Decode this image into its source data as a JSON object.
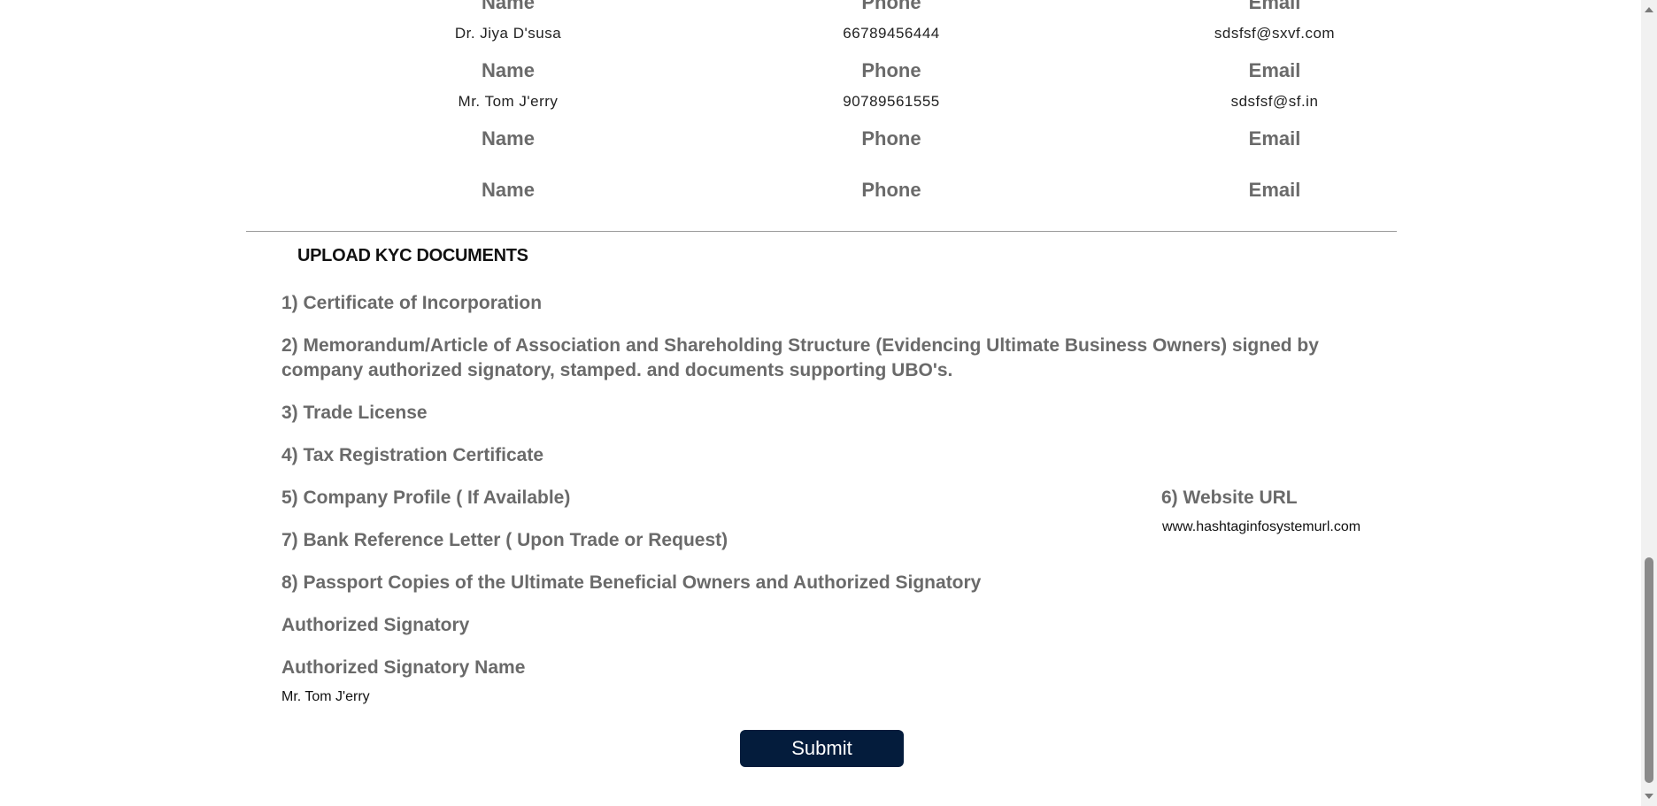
{
  "contacts": {
    "headers": {
      "name": "Name",
      "phone": "Phone",
      "email": "Email"
    },
    "rows": [
      {
        "name": "Dr. Jiya D'susa",
        "phone": "66789456444",
        "email": "sdsfsf@sxvf.com"
      },
      {
        "name": "Mr. Tom J'erry",
        "phone": "90789561555",
        "email": "sdsfsf@sf.in"
      },
      {
        "name": "",
        "phone": "",
        "email": ""
      },
      {
        "name": "",
        "phone": "",
        "email": ""
      }
    ]
  },
  "kyc": {
    "title": "UPLOAD KYC DOCUMENTS",
    "docs": {
      "d1": "1) Certificate of Incorporation",
      "d2_line1": "2) Memorandum/Article of Association and Shareholding Structure (Evidencing Ultimate Business Owners) signed by",
      "d2_line2": "company authorized signatory, stamped. and documents supporting UBO's.",
      "d3": "3) Trade License",
      "d4": "4) Tax Registration Certificate",
      "d5": "5) Company Profile ( If Available)",
      "d6": "6) Website URL",
      "d7": "7) Bank Reference Letter ( Upon Trade or Request)",
      "d8": "8) Passport Copies of the Ultimate Beneficial Owners and Authorized Signatory"
    },
    "website_url_value": "www.hashtaginfosystemurl.com",
    "authorized_signatory_label": "Authorized Signatory",
    "authorized_signatory_name_label": "Authorized Signatory Name",
    "authorized_signatory_name_value": "Mr. Tom J'erry"
  },
  "submit_label": "Submit"
}
